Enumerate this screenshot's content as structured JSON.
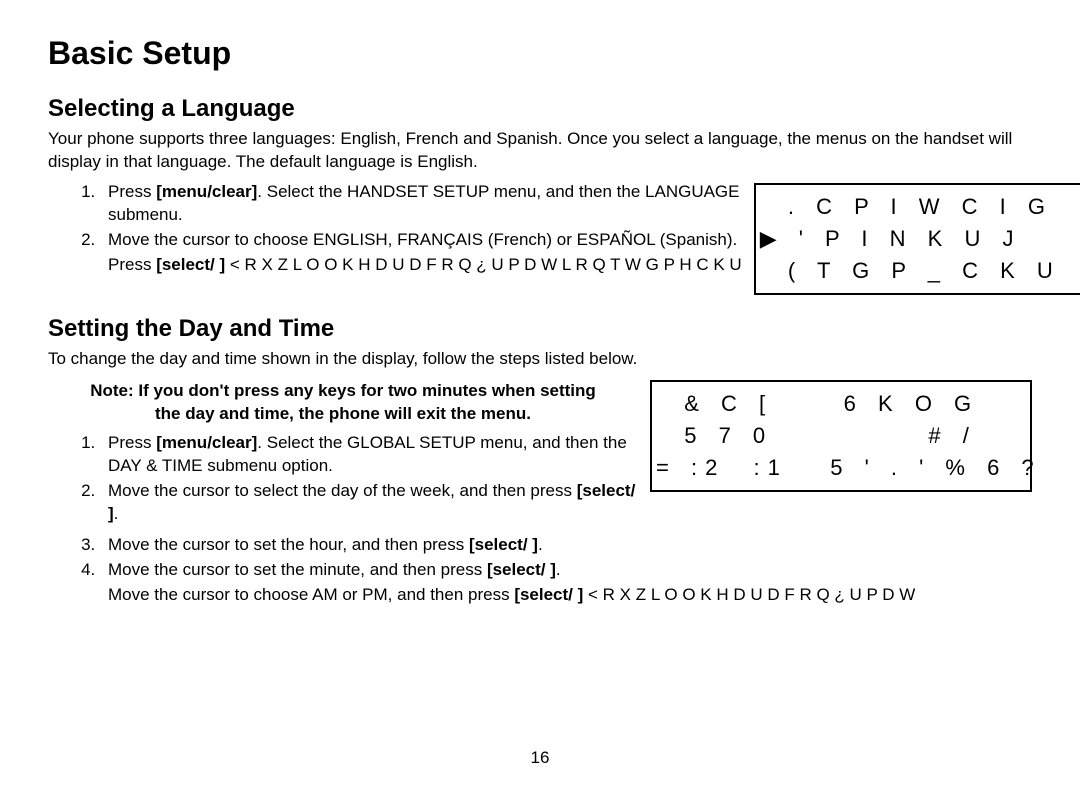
{
  "title": "Basic Setup",
  "section1": {
    "heading": "Selecting a Language",
    "intro": "Your phone supports three languages: English, French and Spanish. Once you select a language, the menus on the handset will display in that language. The default language is English.",
    "steps": {
      "s1a": "Press ",
      "s1b": "[menu/clear]",
      "s1c": ". Select the HANDSET SETUP menu, and then the LANGUAGE submenu.",
      "s2": "Move the cursor to choose ENGLISH, FRANÇAIS (French) or ESPAÑOL (Spanish).",
      "s3a": "Press ",
      "s3b": "[select/   ]",
      "s3c": " < R X   Z L O O   K H D U   D   F R Q ¿ U P D W L R Q T W G P H  C K U"
    },
    "display": {
      "r1": "  . C P I W C I G",
      "r2": "▶ ' P I N K U J",
      "r3": "  ( T G P _ C K U"
    }
  },
  "section2": {
    "heading": "Setting the Day and Time",
    "intro": "To change the day and time shown in the display, follow the steps listed below.",
    "note": "Note: If you don't press any keys for two minutes when setting the day and time, the phone will exit the menu.",
    "steps": {
      "s1a": "Press ",
      "s1b": "[menu/clear]",
      "s1c": ". Select the GLOBAL SETUP menu, and then the DAY & TIME submenu option.",
      "s2a": "Move the cursor to select the day of the week, and then press ",
      "s2b": "[select/   ]",
      "s2c": ".",
      "s3a": "Move the cursor to set the hour, and then press ",
      "s3b": "[select/   ]",
      "s3c": ".",
      "s4a": "Move the cursor to set the minute, and then press ",
      "s4b": "[select/   ]",
      "s4c": ".",
      "s5a": "Move the cursor to choose AM or PM, and then press ",
      "s5b": "[select/   ]",
      "s5c": "  < R X   Z L O O   K H D U   D   F R Q ¿ U P D W"
    },
    "display": {
      "r1": "  & C [     6 K O G",
      "r2": "  5 7 0           # /",
      "r3": "= :2  :1   5 ' . ' % 6 ?"
    }
  },
  "page": "16"
}
